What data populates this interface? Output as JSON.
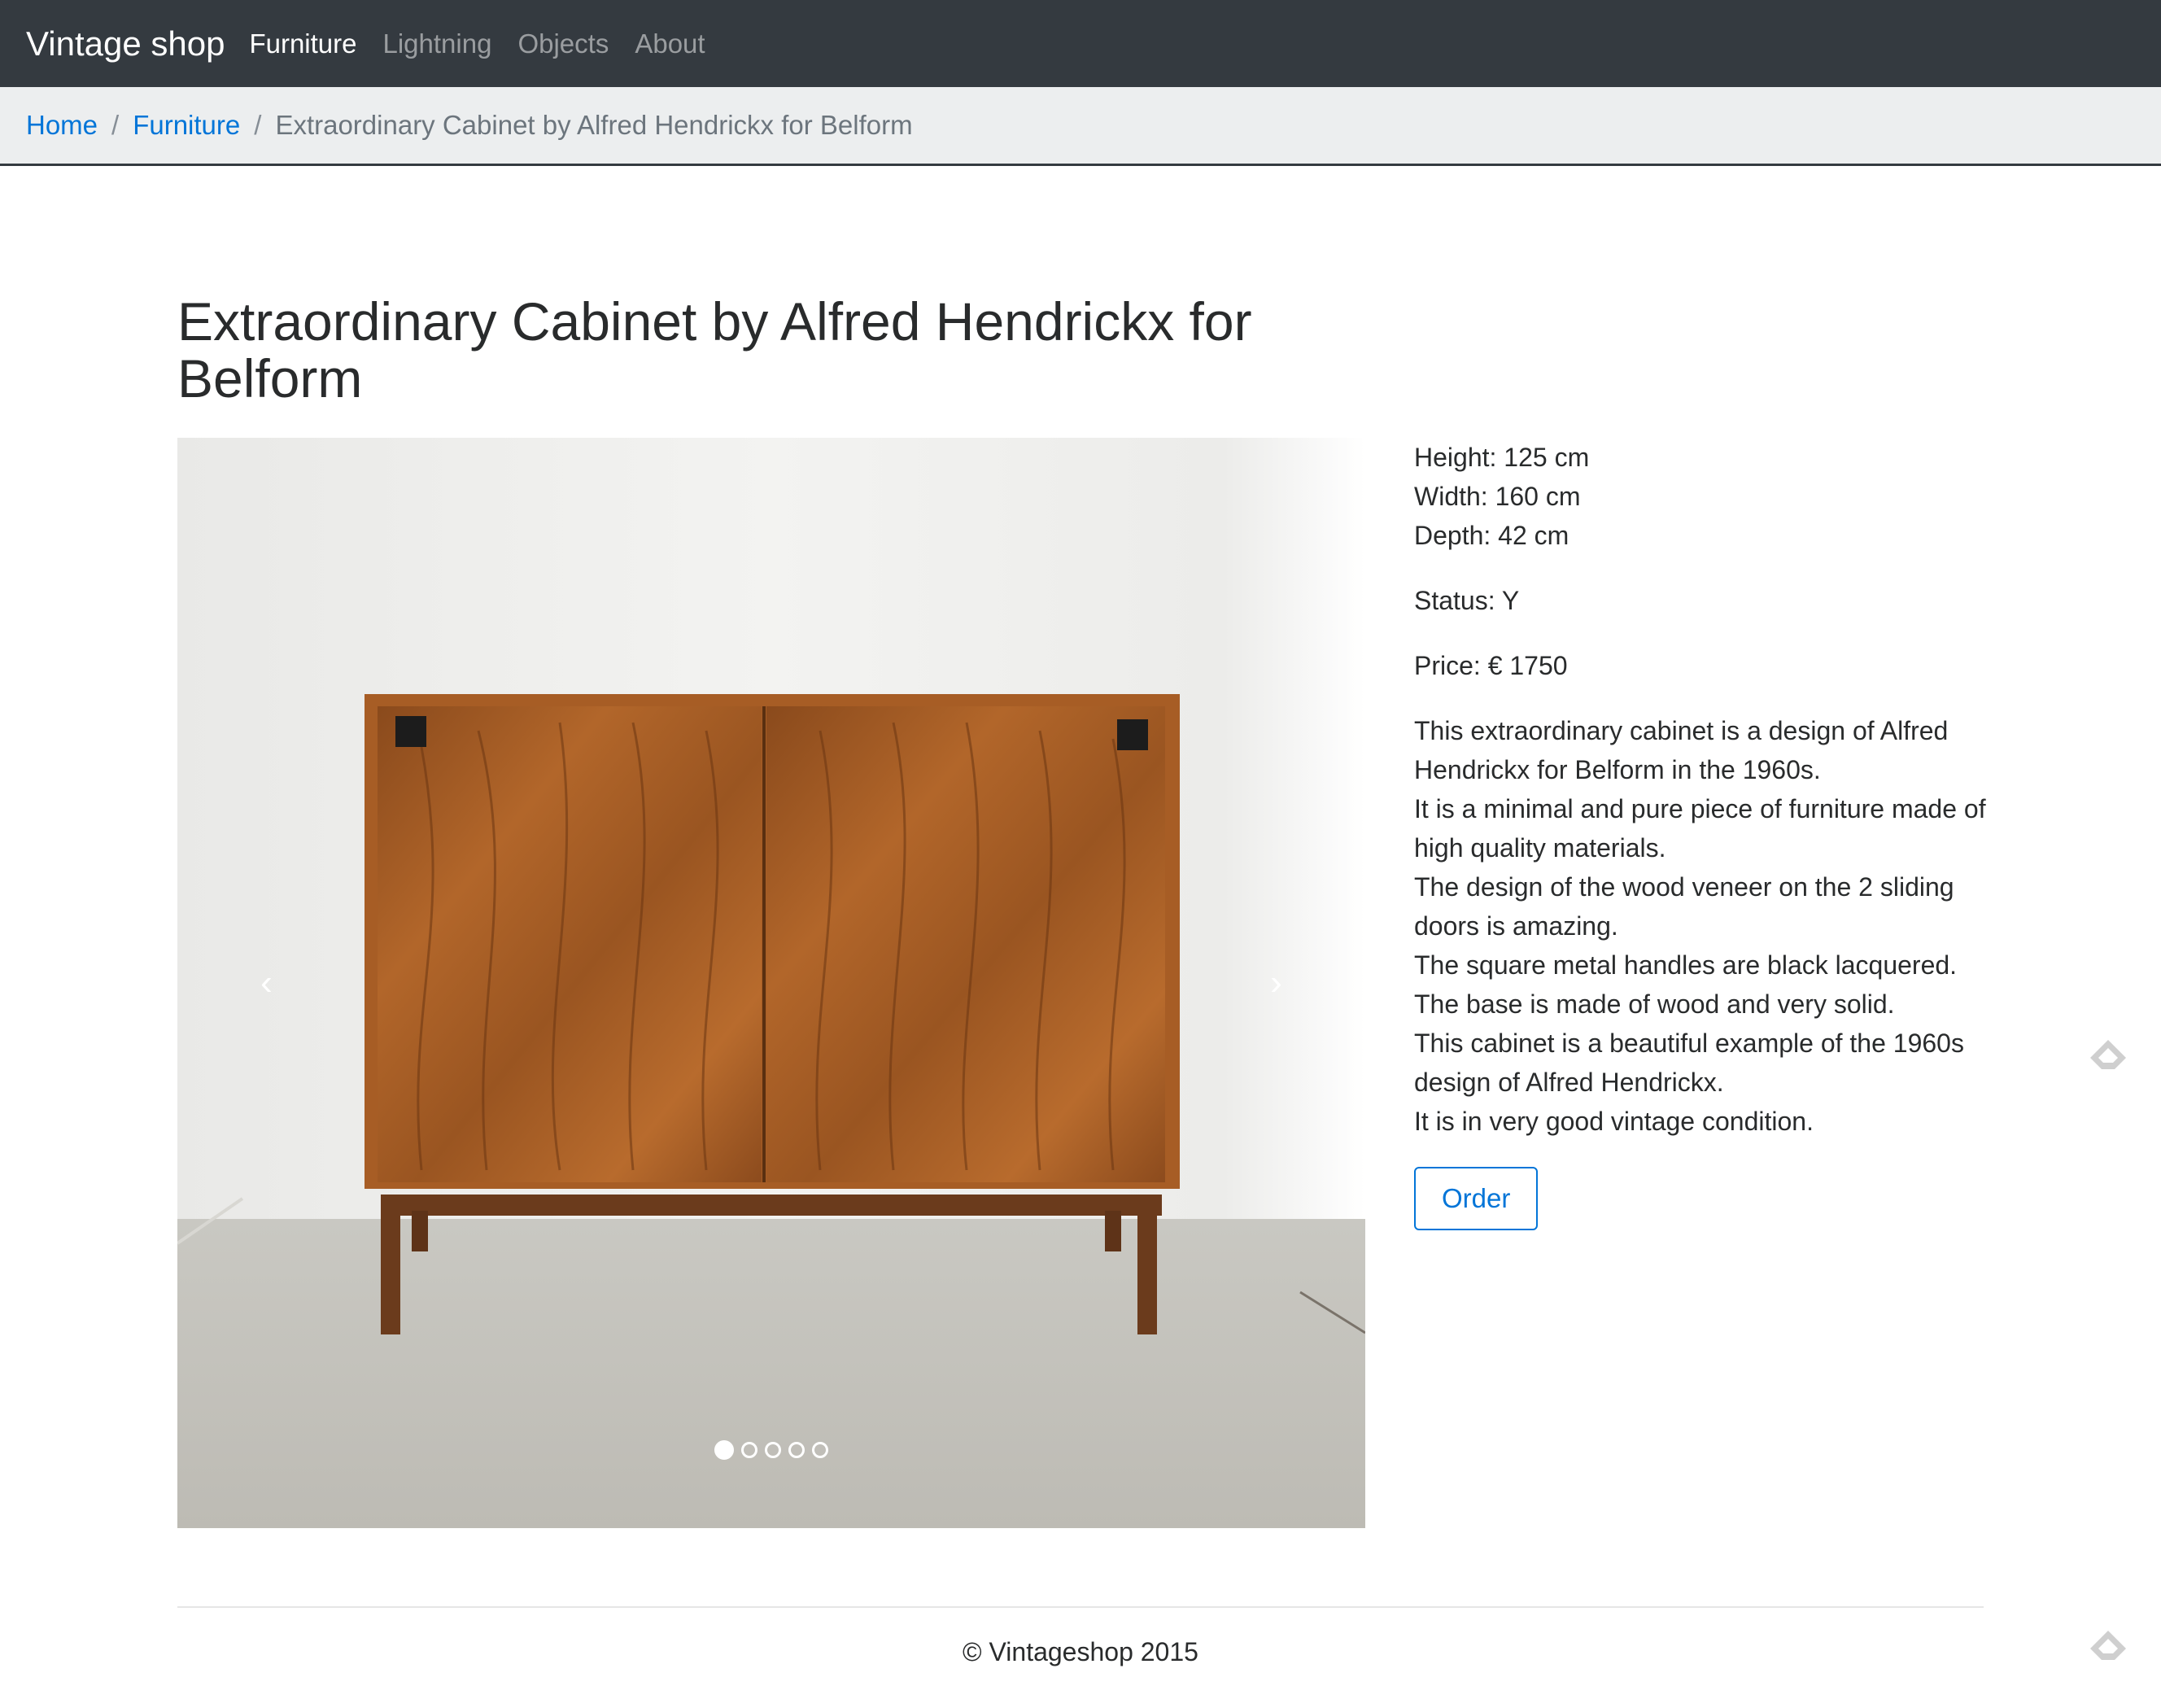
{
  "navbar": {
    "brand": "Vintage shop",
    "links": [
      {
        "label": "Furniture",
        "active": true
      },
      {
        "label": "Lightning",
        "active": false
      },
      {
        "label": "Objects",
        "active": false
      },
      {
        "label": "About",
        "active": false
      }
    ]
  },
  "breadcrumb": {
    "home": "Home",
    "separator": "/",
    "category": "Furniture",
    "current": "Extraordinary Cabinet by Alfred Hendrickx for Belform"
  },
  "product": {
    "title": "Extraordinary Cabinet by Alfred Hendrickx for Belform",
    "height": "Height: 125 cm",
    "width": "Width: 160 cm",
    "depth": "Depth: 42 cm",
    "status": "Status: Y",
    "price": "Price: € 1750",
    "description": [
      "This extraordinary cabinet is a design of Alfred Hendrickx for Belform in the 1960s.",
      "It is a minimal and pure piece of furniture made of high quality materials.",
      "The design of the wood veneer on the 2 sliding doors is amazing.",
      "The square metal handles are black lacquered.",
      "The base is made of wood and very solid.",
      "This cabinet is a beautiful example of the 1960s design of Alfred Hendrickx.",
      "It is in very good vintage condition."
    ],
    "order_label": "Order"
  },
  "carousel": {
    "prev_icon": "chevron-left-icon",
    "next_icon": "chevron-right-icon",
    "prev_glyph": "‹",
    "next_glyph": "›",
    "slide_count": 5,
    "active_index": 0
  },
  "footer": {
    "text": "© Vintageshop 2015"
  },
  "colors": {
    "navbar_bg": "#343a40",
    "link_blue": "#0275d8",
    "breadcrumb_bg": "#eceeef"
  }
}
